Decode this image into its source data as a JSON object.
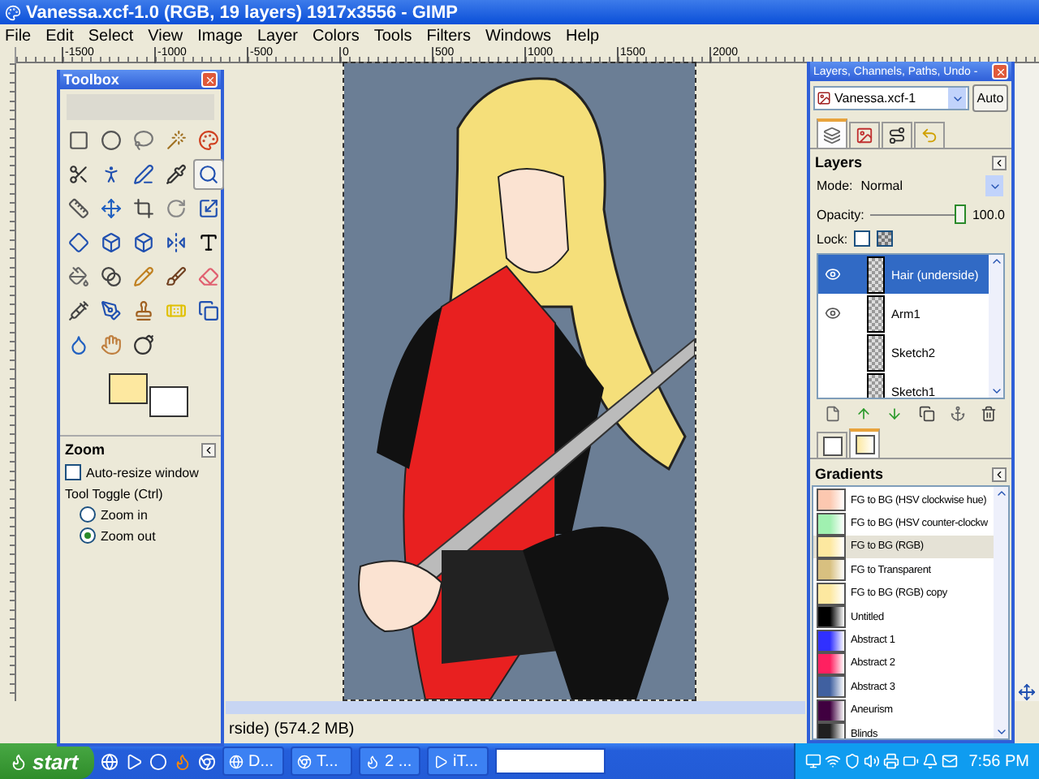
{
  "window": {
    "title": "Vanessa.xcf-1.0 (RGB, 19 layers) 1917x3556 - GIMP"
  },
  "menu": [
    "File",
    "Edit",
    "Select",
    "View",
    "Image",
    "Layer",
    "Colors",
    "Tools",
    "Filters",
    "Windows",
    "Help"
  ],
  "ruler": [
    "-1500",
    "-1000",
    "-500",
    "0",
    "500",
    "1000",
    "1500",
    "2000"
  ],
  "status_bar": {
    "text": "rside) (574.2 MB)"
  },
  "toolbox": {
    "title": "Toolbox",
    "tools": [
      {
        "selected": false
      },
      {
        "selected": false
      },
      {
        "selected": false
      },
      {
        "selected": false
      },
      {
        "selected": false
      },
      {
        "selected": false
      },
      {
        "selected": false
      },
      {
        "selected": false
      },
      {
        "selected": false
      },
      {
        "selected": true
      },
      {
        "selected": false
      },
      {
        "selected": false
      },
      {
        "selected": false
      },
      {
        "selected": false
      },
      {
        "selected": false
      },
      {
        "selected": false
      },
      {
        "selected": false
      },
      {
        "selected": false
      },
      {
        "selected": false
      },
      {
        "selected": false
      },
      {
        "selected": false
      },
      {
        "selected": false
      },
      {
        "selected": false
      },
      {
        "selected": false
      },
      {
        "selected": false
      },
      {
        "selected": false
      },
      {
        "selected": false
      },
      {
        "selected": false
      },
      {
        "selected": false
      },
      {
        "selected": false
      },
      {
        "selected": false
      },
      {
        "selected": false
      },
      {
        "selected": false
      }
    ],
    "options": {
      "title": "Zoom",
      "auto_resize": {
        "label": "Auto-resize window",
        "checked": false
      },
      "toggle_label": "Tool Toggle  (Ctrl)",
      "modes": [
        {
          "label": "Zoom in",
          "selected": false
        },
        {
          "label": "Zoom out",
          "selected": true
        }
      ]
    }
  },
  "dock": {
    "title": "Layers, Channels, Paths, Undo -",
    "image": "Vanessa.xcf-1",
    "auto": "Auto",
    "tabs": [
      {
        "selected": true
      },
      {
        "selected": false
      },
      {
        "selected": false
      },
      {
        "selected": false
      }
    ],
    "layers": {
      "title": "Layers",
      "mode_label": "Mode:",
      "mode": "Normal",
      "opacity_label": "Opacity:",
      "opacity": {
        "level": 1.0
      },
      "opacity_value": "100.0",
      "lock_label": "Lock:",
      "lock": [
        {
          "checked": false
        },
        {
          "checked": false
        }
      ],
      "items": [
        {
          "name": "Hair (underside)",
          "visible": true,
          "selected": true
        },
        {
          "name": "Arm1",
          "visible": true,
          "selected": false
        },
        {
          "name": "Sketch2",
          "visible": false,
          "selected": false
        },
        {
          "name": "Sketch1",
          "visible": false,
          "selected": false
        }
      ]
    },
    "lower_tabs": [
      {
        "selected": false
      },
      {
        "selected": true
      }
    ],
    "gradients": {
      "title": "Gradients",
      "items": [
        {
          "name": "FG to BG (HSV clockwise hue)",
          "color": "#fcc8b0",
          "selected": false
        },
        {
          "name": "FG to BG (HSV counter-clockw",
          "color": "#a0f0b0",
          "selected": false
        },
        {
          "name": "FG to BG (RGB)",
          "color": "#fde8a0",
          "selected": true
        },
        {
          "name": "FG to Transparent",
          "color": "#d8c080",
          "selected": false
        },
        {
          "name": "FG to BG (RGB) copy",
          "color": "#fde8a0",
          "selected": false
        },
        {
          "name": "Untitled",
          "color": "#000000",
          "selected": false
        },
        {
          "name": "Abstract 1",
          "color": "#3030ff",
          "selected": false
        },
        {
          "name": "Abstract 2",
          "color": "#ff2060",
          "selected": false
        },
        {
          "name": "Abstract 3",
          "color": "#4060a0",
          "selected": false
        },
        {
          "name": "Aneurism",
          "color": "#400040",
          "selected": false
        },
        {
          "name": "Blinds",
          "color": "#202020",
          "selected": false
        }
      ]
    }
  },
  "taskbar": {
    "start": "start",
    "tasks": [
      {
        "label": "D..."
      },
      {
        "label": "T..."
      },
      {
        "label": "2 ..."
      },
      {
        "label": "iT..."
      }
    ],
    "clock": "7:56 PM"
  }
}
